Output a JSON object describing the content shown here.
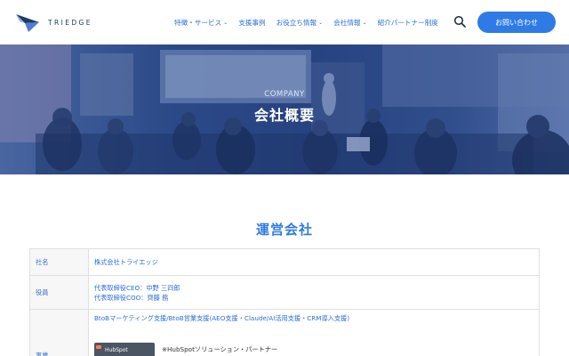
{
  "header": {
    "logo_text": "TRIEDGE",
    "nav": [
      {
        "label": "特徴・サービス",
        "dropdown": true
      },
      {
        "label": "支援事例",
        "dropdown": false
      },
      {
        "label": "お役立ち情報",
        "dropdown": true
      },
      {
        "label": "会社情報",
        "dropdown": true
      },
      {
        "label": "紹介パートナー制度",
        "dropdown": false
      }
    ],
    "contact_label": "お問い合わせ",
    "accent_color": "#2f7be5"
  },
  "hero": {
    "subtitle": "COMPANY",
    "title": "会社概要"
  },
  "section": {
    "title": "運営会社"
  },
  "table": {
    "rows": [
      {
        "label": "社名",
        "values": [
          "株式会社トライエッジ"
        ]
      },
      {
        "label": "役員",
        "values": [
          "代表取締役CEO：中野 三四郎",
          "代表取締役COO：齊藤 務"
        ]
      },
      {
        "label": "事業",
        "values": [
          "BtoBマーケティング支援/BtoB営業支援(AEO支援・Claude/AI活用支援・CRM導入支援)"
        ],
        "badge_text": "HubSpot",
        "partner_note": "※HubSpotソリューション・パートナー"
      }
    ]
  },
  "icons": {
    "search": "search-icon",
    "dropdown": "chevron-down-icon",
    "logo": "triedge-logo-icon"
  }
}
